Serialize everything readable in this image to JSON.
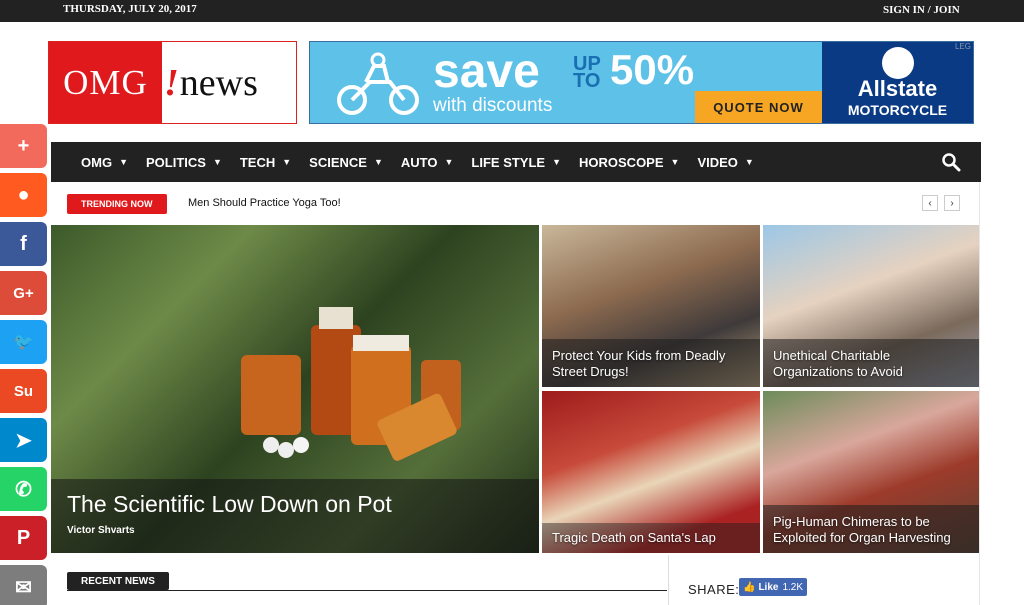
{
  "topbar": {
    "date": "THURSDAY, JULY 20, 2017",
    "signin": "SIGN IN / JOIN"
  },
  "logo": {
    "left": "OMG",
    "bang": "!",
    "right": "news"
  },
  "ad": {
    "save": "save",
    "upto": "UP TO",
    "pct": "50%",
    "discounts": "with discounts",
    "quote": "QUOTE NOW",
    "brand": "Allstate",
    "product": "MOTORCYCLE",
    "tag": "LEG"
  },
  "nav": {
    "items": [
      "OMG",
      "POLITICS",
      "TECH",
      "SCIENCE",
      "AUTO",
      "LIFE STYLE",
      "HOROSCOPE",
      "VIDEO"
    ]
  },
  "trending": {
    "label": "TRENDING NOW",
    "headline": "Men Should Practice Yoga Too!",
    "prev": "‹",
    "next": "›"
  },
  "featured": {
    "title": "The Scientific Low Down on Pot",
    "author": "Victor Shvarts"
  },
  "tiles": [
    {
      "title": "Protect Your Kids from Deadly Street Drugs!"
    },
    {
      "title": "Unethical Charitable Organizations to Avoid"
    },
    {
      "title": "Tragic Death on Santa's Lap"
    },
    {
      "title": "Pig-Human Chimeras to be Exploited for Organ Harvesting"
    }
  ],
  "social": [
    {
      "name": "share-more",
      "glyph": "+",
      "color": "#f26a5c"
    },
    {
      "name": "reddit",
      "glyph": "●",
      "color": "#ff5a1f"
    },
    {
      "name": "facebook",
      "glyph": "f",
      "color": "#3b5998"
    },
    {
      "name": "google-plus",
      "glyph": "G+",
      "color": "#dd4b39"
    },
    {
      "name": "twitter",
      "glyph": "🐦",
      "color": "#1da1f2"
    },
    {
      "name": "stumbleupon",
      "glyph": "Su",
      "color": "#eb4924"
    },
    {
      "name": "telegram",
      "glyph": "➤",
      "color": "#0088cc"
    },
    {
      "name": "whatsapp",
      "glyph": "✆",
      "color": "#25d366"
    },
    {
      "name": "pinterest",
      "glyph": "P",
      "color": "#cb2027"
    },
    {
      "name": "email",
      "glyph": "✉",
      "color": "#7d7d7d"
    }
  ],
  "recent": {
    "label": "RECENT NEWS"
  },
  "share": {
    "label": "SHARE:",
    "like": "Like",
    "count": "1.2K"
  }
}
